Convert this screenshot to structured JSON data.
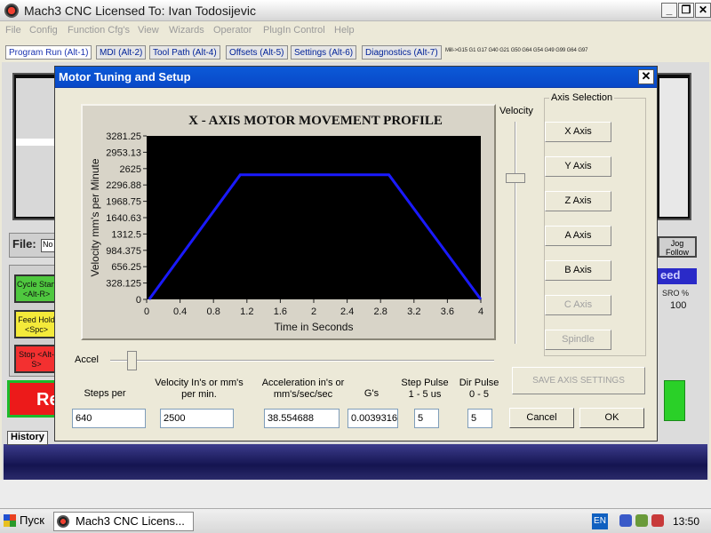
{
  "window": {
    "title": "Mach3 CNC  Licensed To: Ivan Todosijevic",
    "minimize": "_",
    "restore": "❐",
    "close": "✕"
  },
  "menu": [
    "File",
    "Config",
    "Function Cfg's",
    "View",
    "Wizards",
    "Operator",
    "PlugIn Control",
    "Help"
  ],
  "tabs": [
    "Program Run (Alt-1)",
    "MDI (Alt-2)",
    "Tool Path (Alt-4)",
    "Offsets (Alt-5)",
    "Settings (Alt-6)",
    "Diagnostics (Alt-7)"
  ],
  "gcode_modes": "Mill->G15  G1 G17 G40 G21 G50 G64 G54 G49 G99 G64 G97",
  "main": {
    "file_label": "File:",
    "file_value": "No",
    "cycle_start": "Cycle Start <Alt-R>",
    "feed_hold": "Feed Hold <Spc>",
    "stop": "Stop <Alt-S>",
    "reset": "Re",
    "history": "History",
    "jog_follow": "Jog Follow",
    "speed_tag": "eed",
    "sro_label": "SRO %",
    "sro_value": "100"
  },
  "dialog": {
    "title": "Motor Tuning and Setup",
    "close": "✕",
    "velocity_label": "Velocity",
    "accel_label": "Accel",
    "axis_selection_label": "Axis Selection",
    "axes": [
      {
        "label": "X Axis",
        "enabled": true
      },
      {
        "label": "Y Axis",
        "enabled": true
      },
      {
        "label": "Z Axis",
        "enabled": true
      },
      {
        "label": "A Axis",
        "enabled": true
      },
      {
        "label": "B Axis",
        "enabled": true
      },
      {
        "label": "C Axis",
        "enabled": false
      },
      {
        "label": "Spindle",
        "enabled": false
      }
    ],
    "save_axis_settings": "SAVE AXIS SETTINGS",
    "fields": {
      "steps_per": {
        "header": "Steps per",
        "value": "640"
      },
      "velocity": {
        "header": "Velocity In's or mm's per min.",
        "value": "2500"
      },
      "acceleration": {
        "header": "Acceleration in's or mm's/sec/sec",
        "value": "38.554688"
      },
      "gs": {
        "header": "G's",
        "value": "0.0039316"
      },
      "step_pulse": {
        "header": "Step Pulse 1 - 5 us",
        "value": "5"
      },
      "dir_pulse": {
        "header": "Dir Pulse 0 - 5",
        "value": "5"
      }
    },
    "cancel": "Cancel",
    "ok": "OK"
  },
  "chart_data": {
    "type": "line",
    "title": "X - AXIS MOTOR MOVEMENT PROFILE",
    "xlabel": "Time in Seconds",
    "ylabel": "Velocity mm's per Minute",
    "xlim": [
      0,
      4
    ],
    "ylim": [
      0,
      3281.25
    ],
    "x_ticks": [
      "0",
      "0.4",
      "0.8",
      "1.2",
      "1.6",
      "2",
      "2.4",
      "2.8",
      "3.2",
      "3.6",
      "4"
    ],
    "y_ticks": [
      "0",
      "328.125",
      "656.25",
      "984.375",
      "1312.5",
      "1640.63",
      "1968.75",
      "2296.88",
      "2625",
      "2953.13",
      "3281.25"
    ],
    "grid": false,
    "background": "#000000",
    "line_color": "#1a1aff",
    "series": [
      {
        "x": [
          0.03,
          1.12,
          2.9,
          4.0
        ],
        "y": [
          0,
          2500,
          2500,
          0
        ]
      }
    ]
  },
  "taskbar": {
    "start": "Пуск",
    "task": "Mach3 CNC  Licens...",
    "lang": "EN",
    "clock": "13:50"
  }
}
